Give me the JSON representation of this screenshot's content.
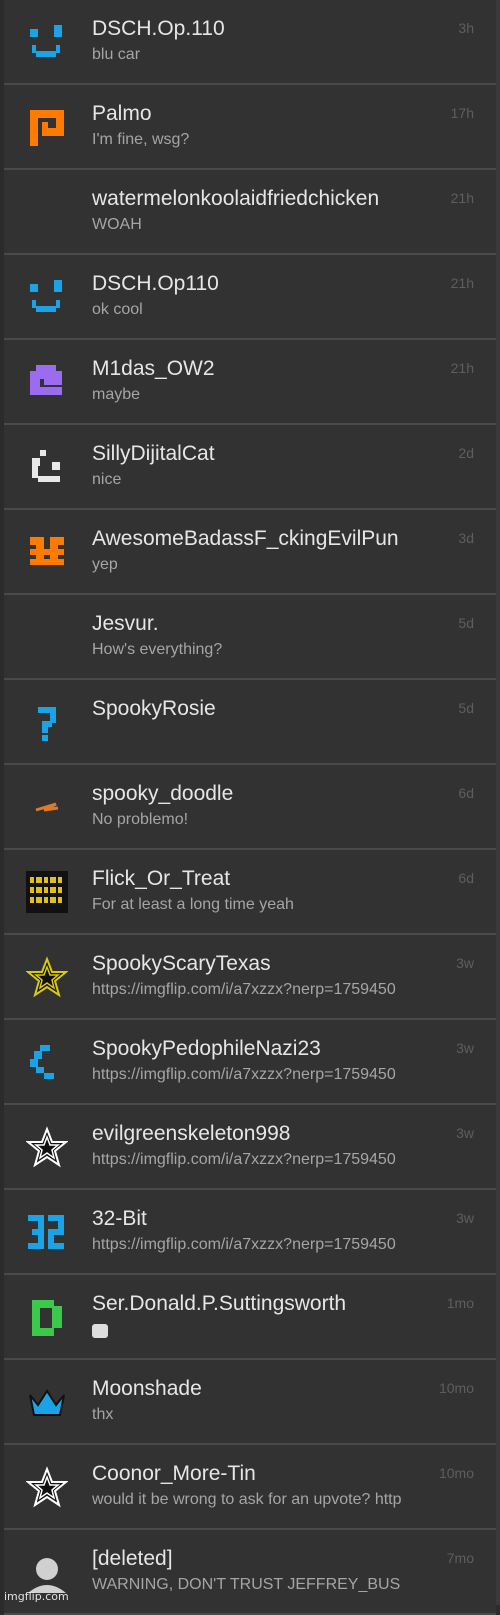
{
  "conversations": [
    {
      "name": "DSCH.Op.110",
      "message": "blu car",
      "time": "3h",
      "icon": "face-icon",
      "color": "#1aa3e6"
    },
    {
      "name": "Palmo",
      "message": "I'm fine, wsg?",
      "time": "17h",
      "icon": "p-icon",
      "color": "#ff7a00"
    },
    {
      "name": "watermelonkoolaidfriedchicken",
      "message": "WOAH",
      "time": "21h",
      "icon": "none",
      "color": ""
    },
    {
      "name": "DSCH.Op110",
      "message": "ok cool",
      "time": "21h",
      "icon": "face-icon",
      "color": "#1aa3e6"
    },
    {
      "name": "M1das_OW2",
      "message": "maybe",
      "time": "21h",
      "icon": "blob-icon",
      "color": "#9b6cf0"
    },
    {
      "name": "SillyDijitalCat",
      "message": "nice",
      "time": "2d",
      "icon": "cat-icon",
      "color": "#e8e8e8"
    },
    {
      "name": "AwesomeBadassF_ckingEvilPun",
      "message": "yep",
      "time": "3d",
      "icon": "hash-icon",
      "color": "#ff7a00"
    },
    {
      "name": "Jesvur.",
      "message": "How's everything?",
      "time": "5d",
      "icon": "none",
      "color": ""
    },
    {
      "name": "SpookyRosie",
      "message": "",
      "time": "5d",
      "icon": "question-icon",
      "color": "#1aa3e6"
    },
    {
      "name": "spooky_doodle",
      "message": "No problemo!",
      "time": "6d",
      "icon": "squiggle-icon",
      "color": "#e07a2a"
    },
    {
      "name": "Flick_Or_Treat",
      "message": "For at least a long time yeah",
      "time": "6d",
      "icon": "binary-icon",
      "color": "#e0c020"
    },
    {
      "name": "SpookyScaryTexas",
      "message": "https://imgflip.com/i/a7xzzx?nerp=1759450",
      "time": "3w",
      "icon": "star-icon",
      "color": "#d8c81a"
    },
    {
      "name": "SpookyPedophileNazi23",
      "message": "https://imgflip.com/i/a7xzzx?nerp=1759450",
      "time": "3w",
      "icon": "c-icon",
      "color": "#1aa3e6"
    },
    {
      "name": "evilgreenskeleton998",
      "message": "https://imgflip.com/i/a7xzzx?nerp=1759450",
      "time": "3w",
      "icon": "star-icon",
      "color": "#ffffff"
    },
    {
      "name": "32-Bit",
      "message": "https://imgflip.com/i/a7xzzx?nerp=1759450",
      "time": "3w",
      "icon": "32-icon",
      "color": "#1aa3e6"
    },
    {
      "name": "Ser.Donald.P.Suttingsworth",
      "message": "",
      "time": "1mo",
      "icon": "d-icon",
      "color": "#3cc84a",
      "emoji": true
    },
    {
      "name": "Moonshade",
      "message": "thx",
      "time": "10mo",
      "icon": "crown-icon",
      "color": "#1aa3e6"
    },
    {
      "name": "Coonor_More-Tin",
      "message": "would it be wrong to ask for an upvote? http",
      "time": "10mo",
      "icon": "star-icon",
      "color": "#ffffff"
    },
    {
      "name": "[deleted]",
      "message": "WARNING, DON'T TRUST JEFFREY_BUS",
      "time": "7mo",
      "icon": "user-icon",
      "color": "#d0d0d0"
    }
  ],
  "watermark": "imgflip.com"
}
